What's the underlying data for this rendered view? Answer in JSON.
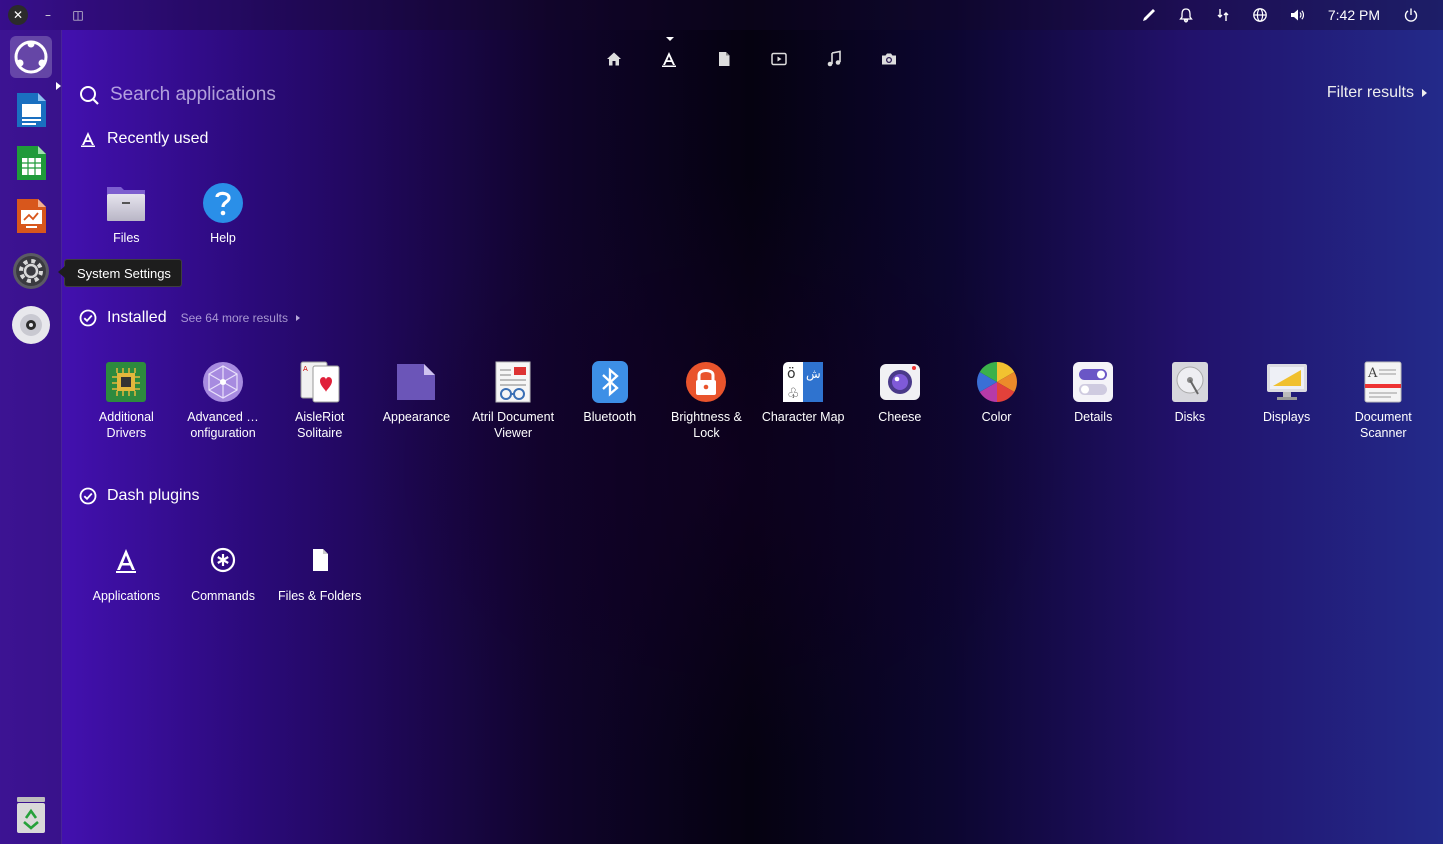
{
  "window_controls": {
    "close": "✕",
    "minimize": "–",
    "restore": "◫"
  },
  "indicators": {
    "clock": "7:42 PM"
  },
  "launcher": {
    "tooltip": "System Settings"
  },
  "lenses": [
    {
      "name": "home",
      "icon": "home-icon"
    },
    {
      "name": "applications",
      "icon": "applications-icon"
    },
    {
      "name": "files",
      "icon": "file-icon"
    },
    {
      "name": "video",
      "icon": "video-icon"
    },
    {
      "name": "music",
      "icon": "music-icon"
    },
    {
      "name": "photos",
      "icon": "camera-icon"
    }
  ],
  "search": {
    "placeholder": "Search applications"
  },
  "filter": {
    "label": "Filter results"
  },
  "recent": {
    "title": "Recently used",
    "items": [
      {
        "label": "Files"
      },
      {
        "label": "Help"
      }
    ]
  },
  "installed": {
    "title": "Installed",
    "more": "See 64 more results",
    "items": [
      {
        "label": "Additional Drivers"
      },
      {
        "label": "Advanced … onfiguration"
      },
      {
        "label": "AisleRiot Solitaire"
      },
      {
        "label": "Appearance"
      },
      {
        "label": "Atril Document Viewer"
      },
      {
        "label": "Bluetooth"
      },
      {
        "label": "Brightness & Lock"
      },
      {
        "label": "Character Map"
      },
      {
        "label": "Cheese"
      },
      {
        "label": "Color"
      },
      {
        "label": "Details"
      },
      {
        "label": "Disks"
      },
      {
        "label": "Displays"
      },
      {
        "label": "Document Scanner"
      }
    ]
  },
  "plugins": {
    "title": "Dash plugins",
    "items": [
      {
        "label": "Applications"
      },
      {
        "label": "Commands"
      },
      {
        "label": "Files & Folders"
      }
    ]
  },
  "colors": {
    "accent": "#7a4ff0",
    "launcher_bg": "#321470"
  }
}
